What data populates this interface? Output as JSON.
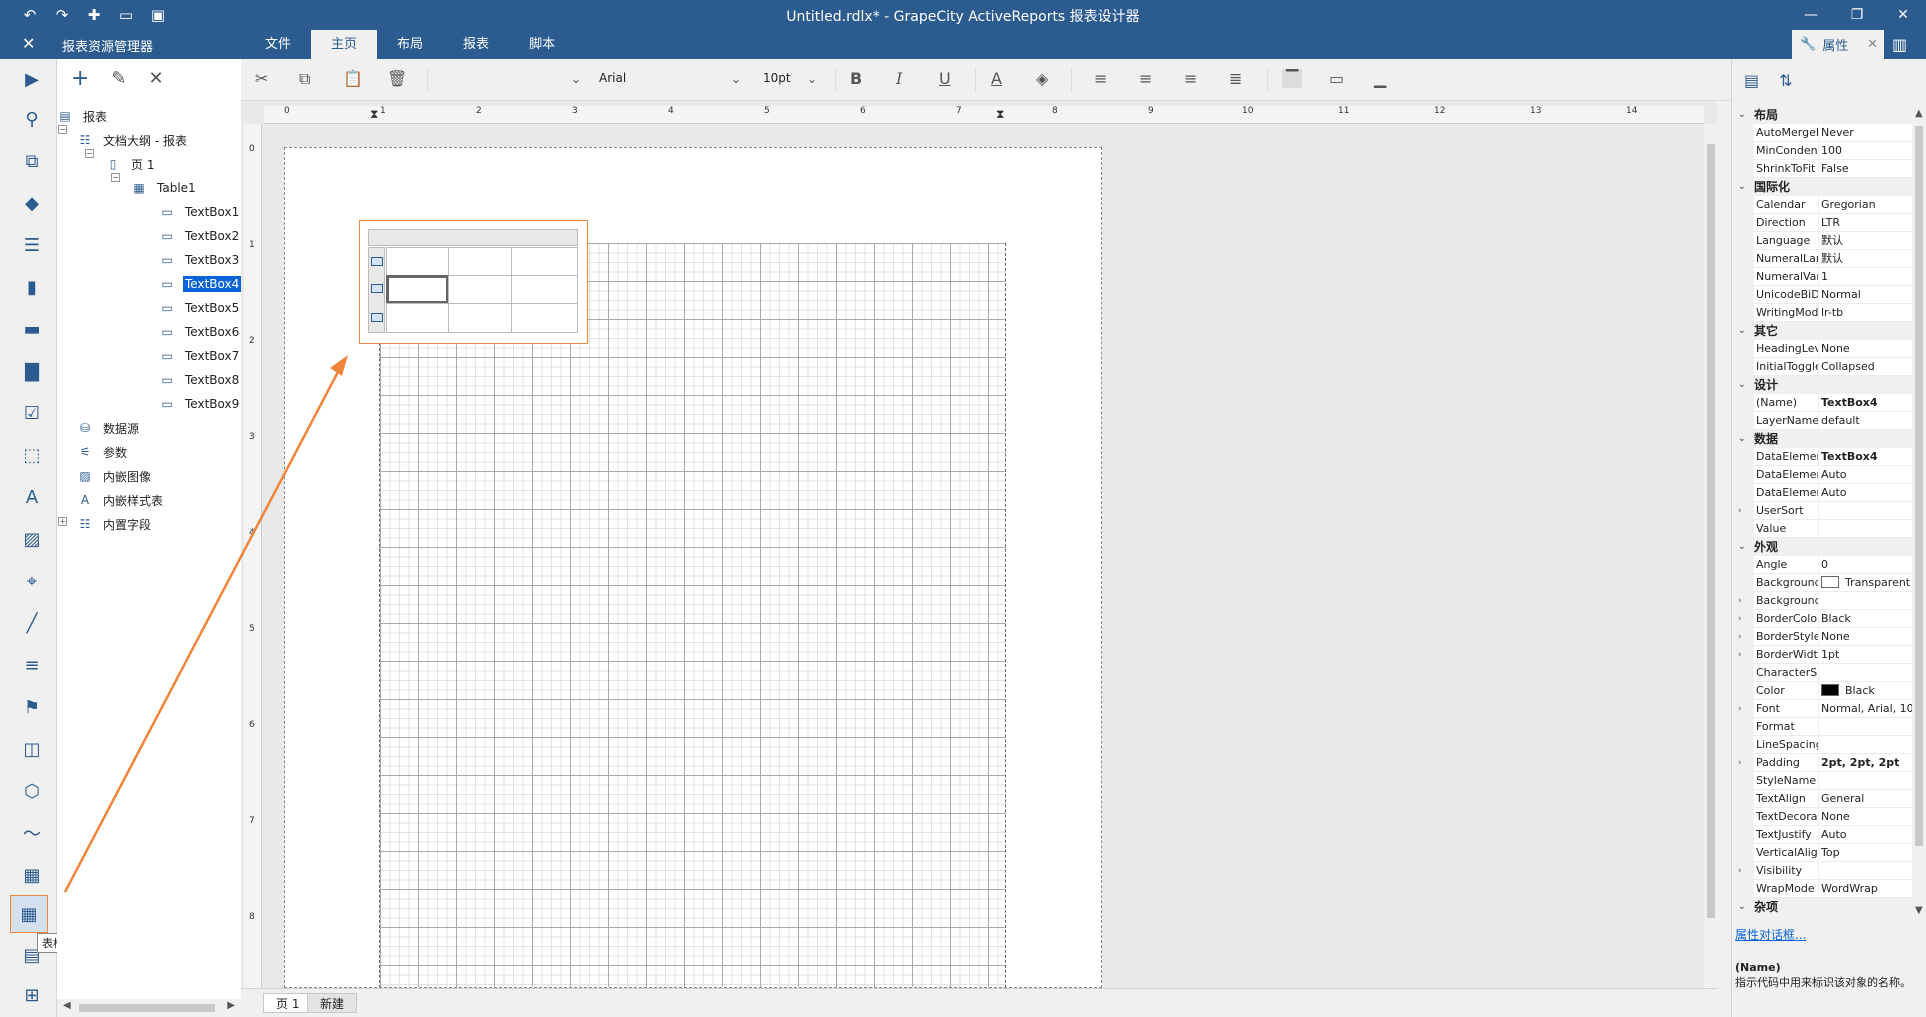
{
  "window": {
    "title": "Untitled.rdlx* - GrapeCity ActiveReports 报表设计器",
    "minimize_icon": "minimize-icon",
    "maximize_icon": "restore-icon",
    "close_icon": "close-icon"
  },
  "menubar": {
    "explorer_title": "报表资源管理器",
    "tabs": [
      {
        "label": "文件"
      },
      {
        "label": "主页"
      },
      {
        "label": "布局"
      },
      {
        "label": "报表"
      },
      {
        "label": "脚本"
      }
    ],
    "properties_tab": "属性"
  },
  "toolbar": {
    "font_name": "Arial",
    "font_size": "10pt"
  },
  "explorer": {
    "root": "报表",
    "outline": "文档大纲 - 报表",
    "page": "页 1",
    "table": "Table1",
    "textboxes": [
      "TextBox1",
      "TextBox2",
      "TextBox3",
      "TextBox4",
      "TextBox5",
      "TextBox6",
      "TextBox7",
      "TextBox8",
      "TextBox9"
    ],
    "selected": "TextBox4",
    "datasource": "数据源",
    "parameters": "参数",
    "embedded_images": "内嵌图像",
    "embedded_stylesheets": "内嵌样式表",
    "builtin_fields": "内置字段"
  },
  "tooltip": "表格",
  "ruler": {
    "h": [
      "0",
      "1",
      "2",
      "3",
      "4",
      "5",
      "6",
      "7",
      "8",
      "9",
      "10",
      "11",
      "12",
      "13",
      "14"
    ],
    "v": [
      "0",
      "1",
      "2",
      "3",
      "4",
      "5",
      "6",
      "7",
      "8"
    ]
  },
  "pagetabs": {
    "page1": "页 1",
    "new": "新建"
  },
  "properties": {
    "groups": [
      {
        "name": "布局",
        "rows": [
          [
            "AutoMergeM",
            "Never"
          ],
          [
            "MinConden:",
            "100"
          ],
          [
            "ShrinkToFit",
            "False"
          ]
        ]
      },
      {
        "name": "国际化",
        "rows": [
          [
            "Calendar",
            "Gregorian"
          ],
          [
            "Direction",
            "LTR"
          ],
          [
            "Language",
            "默认"
          ],
          [
            "NumeralLan",
            "默认"
          ],
          [
            "NumeralVari",
            "1"
          ],
          [
            "UnicodeBiDi",
            "Normal"
          ],
          [
            "WritingMod",
            "lr-tb"
          ]
        ]
      },
      {
        "name": "其它",
        "rows": [
          [
            "HeadingLeve",
            "None"
          ],
          [
            "InitialToggle",
            "Collapsed"
          ]
        ]
      },
      {
        "name": "设计",
        "rows": [
          [
            "(Name)",
            "TextBox4"
          ],
          [
            "LayerName",
            "default"
          ]
        ]
      },
      {
        "name": "数据",
        "rows": [
          [
            "DataElement",
            "TextBox4"
          ],
          [
            "DataElement",
            "Auto"
          ],
          [
            "DataElement",
            "Auto"
          ],
          [
            "UserSort",
            ""
          ],
          [
            "Value",
            ""
          ]
        ]
      },
      {
        "name": "外观",
        "rows": [
          [
            "Angle",
            "0"
          ],
          [
            "Background",
            "Transparent"
          ],
          [
            "Background",
            ""
          ],
          [
            "BorderColor",
            "Black"
          ],
          [
            "BorderStyle",
            "None"
          ],
          [
            "BorderWidth",
            "1pt"
          ],
          [
            "CharacterSp",
            ""
          ],
          [
            "Color",
            "Black"
          ],
          [
            "Font",
            "Normal, Arial, 10"
          ],
          [
            "Format",
            ""
          ],
          [
            "LineSpacing",
            ""
          ],
          [
            "Padding",
            "2pt, 2pt, 2pt"
          ],
          [
            "StyleName",
            ""
          ],
          [
            "TextAlign",
            "General"
          ],
          [
            "TextDecorati",
            "None"
          ],
          [
            "TextJustify",
            "Auto"
          ],
          [
            "VerticalAlign",
            "Top"
          ],
          [
            "Visibility",
            ""
          ],
          [
            "WrapMode",
            "WordWrap"
          ]
        ]
      },
      {
        "name": "杂项",
        "rows": []
      }
    ],
    "link": "属性对话框...",
    "desc_title": "(Name)",
    "desc_text": "指示代码中用来标识该对象的名称。"
  }
}
